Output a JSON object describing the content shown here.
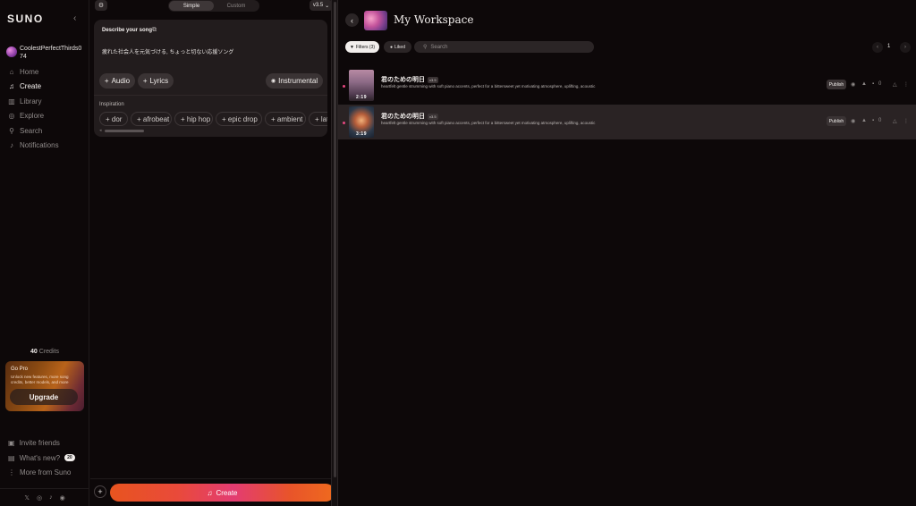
{
  "sidebar": {
    "logo": "SUNO",
    "username": "CoolestPerfectThirds074",
    "nav": [
      {
        "label": "Home",
        "icon": "home-icon",
        "glyph": "⌂"
      },
      {
        "label": "Create",
        "icon": "music-note-icon",
        "glyph": "♫"
      },
      {
        "label": "Library",
        "icon": "library-icon",
        "glyph": "▥"
      },
      {
        "label": "Explore",
        "icon": "explore-icon",
        "glyph": "◎"
      },
      {
        "label": "Search",
        "icon": "search-icon",
        "glyph": "⚲"
      },
      {
        "label": "Notifications",
        "icon": "bell-icon",
        "glyph": "♪"
      }
    ],
    "credits_count": "40",
    "credits_label": "Credits",
    "go_pro": {
      "title": "Go Pro",
      "description": "Unlock new features, more song credits, better models, and more",
      "button": "Upgrade"
    },
    "footer": [
      {
        "label": "Invite friends",
        "icon": "gift-icon"
      },
      {
        "label": "What's new?",
        "icon": "news-icon",
        "badge": "20"
      },
      {
        "label": "More from Suno",
        "icon": "more-vertical-icon"
      }
    ],
    "social": [
      "𝕏",
      "◎",
      "♪",
      "◉"
    ]
  },
  "create": {
    "modes": [
      "Simple",
      "Custom"
    ],
    "active_mode": "Simple",
    "version": "v3.5",
    "prompt_label": "Describe your song",
    "prompt_text": "疲れた社会人を元気づける, ちょっと切ない応援ソング",
    "buttons": {
      "audio": "Audio",
      "lyrics": "Lyrics",
      "instrumental": "Instrumental"
    },
    "inspiration_label": "Inspiration",
    "chips": [
      "dor",
      "afrobeat",
      "hip hop",
      "epic drop",
      "ambient",
      "lat"
    ],
    "create_label": "Create"
  },
  "workspace": {
    "title": "My Workspace",
    "filters_label": "Filters (3)",
    "liked_label": "Liked",
    "search_placeholder": "Search",
    "page": "1",
    "songs": [
      {
        "title": "君のための明日",
        "version": "v3.5",
        "description": "heartfelt gentle strumming with soft piano accents, perfect for a bittersweet yet motivating atmosphere, uplifting, acoustic",
        "duration": "2:19",
        "publish": "Publish",
        "likes": "0"
      },
      {
        "title": "君のための明日",
        "version": "v3.5",
        "description": "heartfelt gentle strumming with soft piano accents, perfect for a bittersweet yet motivating atmosphere, uplifting, acoustic",
        "duration": "3:19",
        "publish": "Publish",
        "likes": "0"
      }
    ]
  },
  "colors": {
    "background": "#0d0809",
    "accent_pink": "#e6477f",
    "create_gradient_start": "#e8541f",
    "create_gradient_end": "#ef6a1e"
  }
}
